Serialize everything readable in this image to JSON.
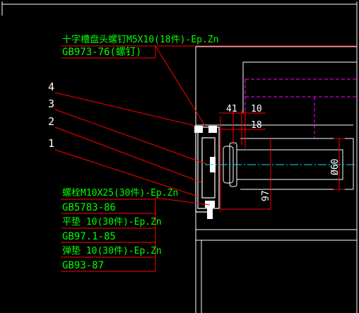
{
  "callouts": [
    {
      "label": "4"
    },
    {
      "label": "3"
    },
    {
      "label": "2"
    },
    {
      "label": "1"
    }
  ],
  "notes": {
    "top_line1": "十字槽盘头螺钉M5X10(18件)-Ep.Zn",
    "top_line2": "GB973-76(螺钉)",
    "bottom": [
      "螺栓M10X25(30件)-Ep.Zn",
      "GB5783-86",
      "平垫 10(30件)-Ep.Zn",
      "GB97.1-85",
      "弹垫 10(30件)-Ep.Zn",
      "GB93-87"
    ]
  },
  "dimensions": {
    "d41": "41",
    "d10": "10",
    "d18": "18",
    "d97": "97",
    "dia60": "Ø60"
  },
  "colors": {
    "background": "#000000",
    "leader": "#ff0000",
    "text": "#00ff00",
    "outline": "#ffffff",
    "dim": "#ffffff",
    "hidden": "#ff00ff",
    "centerline": "#00e5ff"
  }
}
